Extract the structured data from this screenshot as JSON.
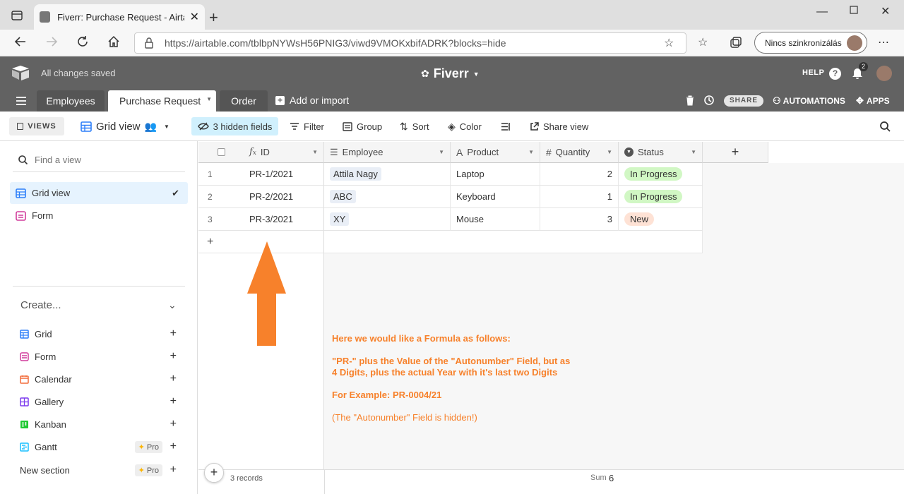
{
  "browser": {
    "tab_title": "Fiverr: Purchase Request - Airtab",
    "url": "https://airtable.com/tblbpNYWsH56PNIG3/viwd9VMOKxbifADRK?blocks=hide",
    "profile_label": "Nincs szinkronizálás"
  },
  "app": {
    "save_status": "All changes saved",
    "base_name": "Fiverr",
    "help_label": "HELP",
    "notif_count": "2",
    "tables": [
      "Employees",
      "Purchase Request",
      "Order"
    ],
    "add_import": "Add or import",
    "share_label": "SHARE",
    "automations_label": "AUTOMATIONS",
    "apps_label": "APPS"
  },
  "viewbar": {
    "views_label": "VIEWS",
    "view_name": "Grid view",
    "hidden_fields": "3 hidden fields",
    "filter": "Filter",
    "group": "Group",
    "sort": "Sort",
    "color": "Color",
    "share_view": "Share view"
  },
  "sidebar": {
    "find_placeholder": "Find a view",
    "views": [
      {
        "label": "Grid view"
      },
      {
        "label": "Form"
      }
    ],
    "create_label": "Create...",
    "create_items": [
      {
        "label": "Grid"
      },
      {
        "label": "Form"
      },
      {
        "label": "Calendar"
      },
      {
        "label": "Gallery"
      },
      {
        "label": "Kanban"
      },
      {
        "label": "Gantt",
        "badge": "Pro"
      },
      {
        "label": "New section",
        "badge": "Pro"
      }
    ]
  },
  "grid": {
    "columns": [
      "ID",
      "Employee",
      "Product",
      "Quantity",
      "Status"
    ],
    "rows": [
      {
        "num": "1",
        "id": "PR-1/2021",
        "employee": "Attila Nagy",
        "product": "Laptop",
        "quantity": "2",
        "status": "In Progress"
      },
      {
        "num": "2",
        "id": "PR-2/2021",
        "employee": "ABC",
        "product": "Keyboard",
        "quantity": "1",
        "status": "In Progress"
      },
      {
        "num": "3",
        "id": "PR-3/2021",
        "employee": "XY",
        "product": "Mouse",
        "quantity": "3",
        "status": "New"
      }
    ],
    "record_count": "3 records",
    "sum_label": "Sum",
    "sum_value": "6"
  },
  "annotation": {
    "line1": "Here we would like a Formula as follows:",
    "line2": "\"PR-\" plus the Value of the \"Autonumber\" Field, but as",
    "line3": "4 Digits, plus the actual Year with it's last two Digits",
    "line4": "For Example: PR-0004/21",
    "line5": "(The \"Autonumber\" Field is hidden!)"
  },
  "colors": {
    "header_bg": "#626262",
    "accent_orange": "#f7812b",
    "in_progress_bg": "#d1f7c4",
    "new_bg": "#fee2d5"
  }
}
